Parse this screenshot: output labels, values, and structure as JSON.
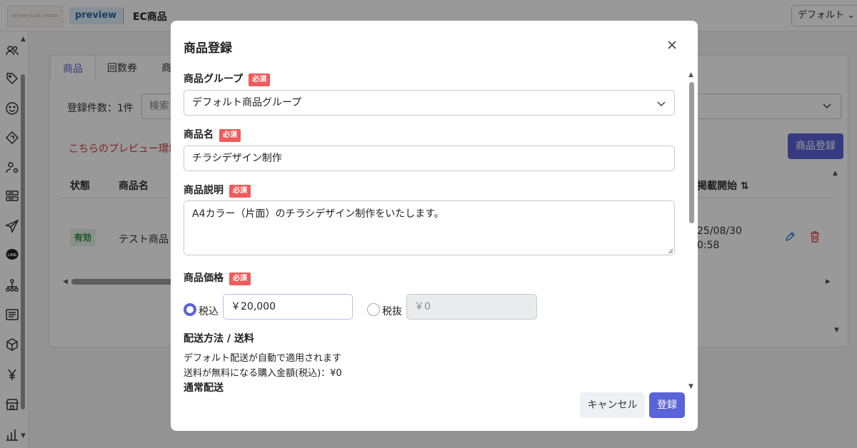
{
  "header": {
    "logo_text": "KATOMI SLICE DESIGN",
    "preview_badge": "preview",
    "app_title": "EC商品",
    "default_select": "デフォルト ⌄"
  },
  "sidebar": {
    "icons": [
      "users-icon",
      "tag-icon",
      "smile-icon",
      "ticket-icon",
      "user-settings-icon",
      "list-box-icon",
      "send-icon",
      "line-icon",
      "hierarchy-icon",
      "document-icon",
      "cube-icon",
      "yen-icon",
      "store-icon",
      "bar-chart-icon"
    ]
  },
  "background": {
    "tabs": [
      "商品",
      "回数券",
      "商"
    ],
    "registration_count": "登録件数：1件",
    "search_placeholder": "検索",
    "warning": "こちらのプレビュー環境",
    "register_button": "商品登録",
    "columns": {
      "status": "状態",
      "name": "商品名",
      "start": "掲載開始 ⇅"
    },
    "row": {
      "status": "有効",
      "name": "テスト商品",
      "date_line1": "25/08/30",
      "date_line2": "0:58"
    }
  },
  "modal": {
    "title": "商品登録",
    "required": "必須",
    "group": {
      "label": "商品グループ",
      "value": "デフォルト商品グループ"
    },
    "name": {
      "label": "商品名",
      "value": "チラシデザイン制作"
    },
    "description": {
      "label": "商品説明",
      "value": "A4カラー（片面）のチラシデザイン制作をいたします。"
    },
    "price": {
      "label": "商品価格",
      "incl_label": "税込",
      "incl_value": "￥20,000",
      "excl_label": "税抜",
      "excl_value": "￥0",
      "selected": "税込"
    },
    "shipping": {
      "title": "配送方法 / 送料",
      "line1": "デフォルト配送が自動で適用されます",
      "line2": "送料が無料になる購入金額(税込)：¥0",
      "subtitle": "通常配送"
    },
    "cancel_button": "キャンセル",
    "submit_button": "登録"
  },
  "colors": {
    "accent": "#5b63d8",
    "required": "#ef5b5b",
    "warning": "#d23b3b"
  }
}
